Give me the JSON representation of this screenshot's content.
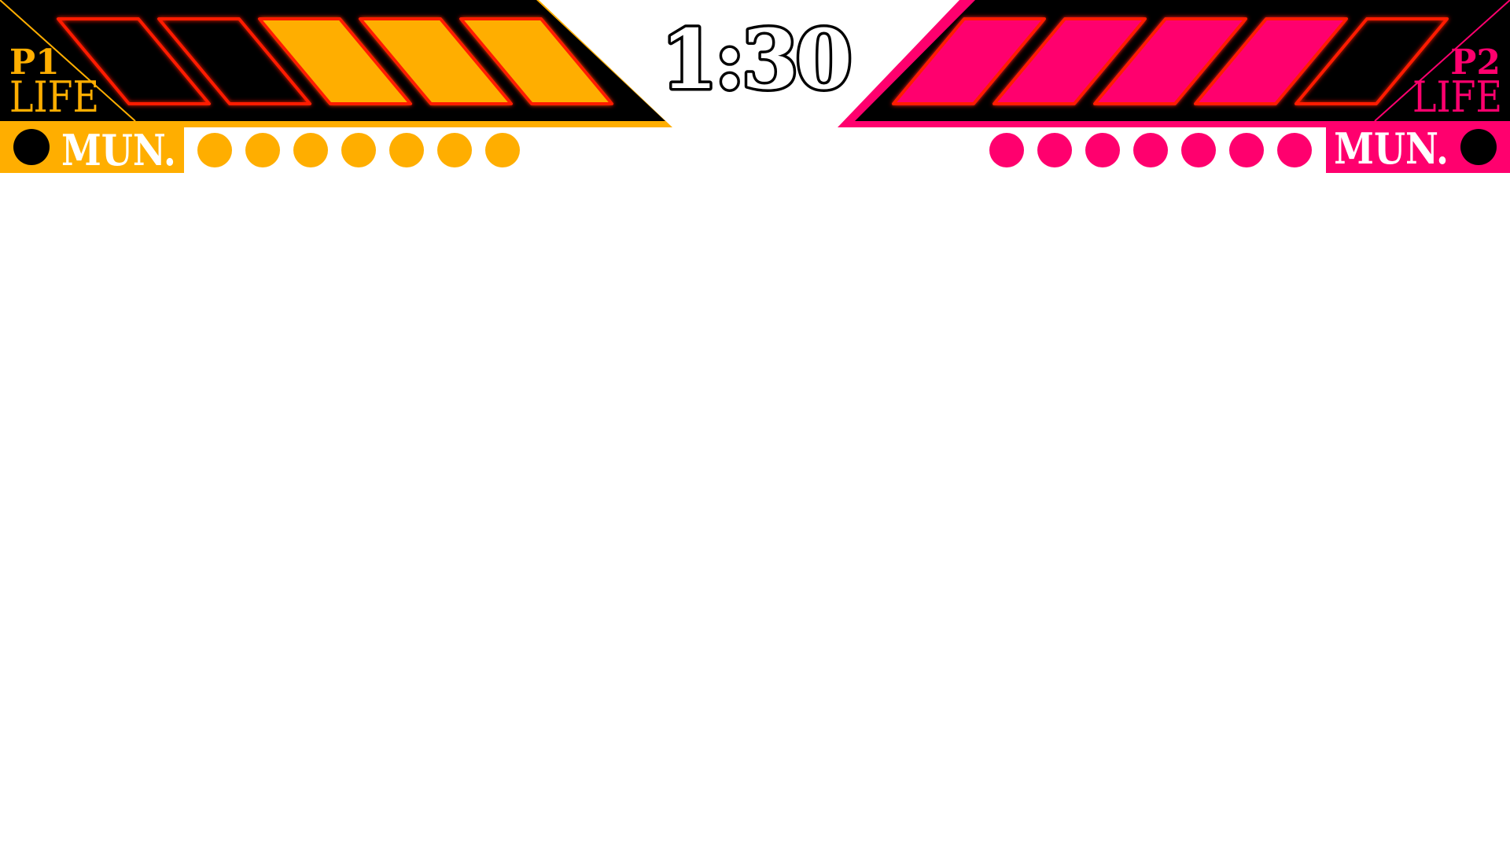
{
  "timer": {
    "text": "1:30"
  },
  "colors": {
    "p1_accent": "#FFAE00",
    "p2_accent": "#FF006E",
    "panel": "#000000",
    "segment_outline": "#FF1A00",
    "background": "#FFFFFF"
  },
  "p1": {
    "tag": "P1",
    "life_label": "LIFE",
    "mun_label": "MUN.",
    "life_segments_total": 5,
    "life_segments_filled": 3,
    "ammo_count": 7
  },
  "p2": {
    "tag": "P2",
    "life_label": "LIFE",
    "mun_label": "MUN.",
    "life_segments_total": 5,
    "life_segments_filled": 4,
    "ammo_count": 7
  }
}
